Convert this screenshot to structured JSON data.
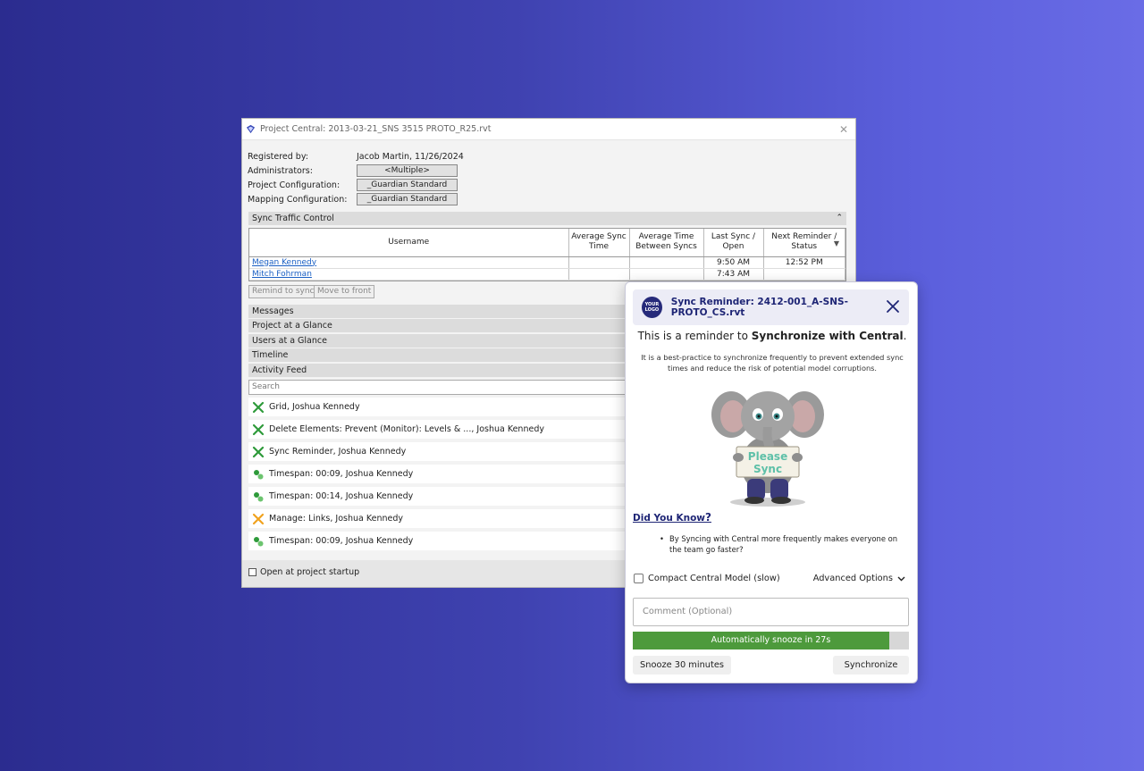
{
  "project_window": {
    "title": "Project Central: 2013-03-21_SNS 3515 PROTO_R25.rvt",
    "info": [
      {
        "label": "Registered by:",
        "value": "Jacob Martin, 11/26/2024"
      },
      {
        "label": "Administrators:",
        "value": "<Multiple>"
      },
      {
        "label": "Project Configuration:",
        "value": "_Guardian Standard"
      },
      {
        "label": "Mapping Configuration:",
        "value": "_Guardian Standard"
      }
    ],
    "sync_section": "Sync Traffic Control",
    "columns": [
      "Username",
      "Average Sync Time",
      "Average Time Between Syncs",
      "Last Sync / Open",
      "Next Reminder / Status"
    ],
    "rows": [
      {
        "user": "Megan Kennedy",
        "avg_sync": "",
        "avg_between": "",
        "last": "9:50 AM",
        "next": "12:52 PM"
      },
      {
        "user": "Mitch Fohrman",
        "avg_sync": "",
        "avg_between": "",
        "last": "7:43 AM",
        "next": ""
      }
    ],
    "buttons": {
      "remind": "Remind to sync",
      "move_front": "Move to front"
    },
    "sections": [
      "Messages",
      "Project at a Glance",
      "Users at a Glance",
      "Timeline",
      "Activity Feed"
    ],
    "search_placeholder": "Search",
    "feed": [
      {
        "text": "Grid, Joshua Kennedy",
        "icon": "tools-icon"
      },
      {
        "text": "Delete Elements: Prevent (Monitor): Levels & ..., Joshua Kennedy",
        "icon": "tools-icon"
      },
      {
        "text": "Sync Reminder, Joshua Kennedy",
        "icon": "tools-icon"
      },
      {
        "text": "Timespan: 00:09, Joshua Kennedy",
        "icon": "timespan-icon"
      },
      {
        "text": "Timespan: 00:14, Joshua Kennedy",
        "icon": "timespan-icon"
      },
      {
        "text": "Manage: Links, Joshua Kennedy",
        "icon": "tools-orange-icon"
      },
      {
        "text": "Timespan: 00:09, Joshua Kennedy",
        "icon": "timespan-icon"
      }
    ],
    "startup_label": "Open at project startup"
  },
  "reminder": {
    "logo_text": "YOUR LOGO",
    "title": "Sync Reminder: 2412-001_A-SNS-PROTO_CS.rvt",
    "heading_pre": "This is a reminder to ",
    "heading_bold": "Synchronize with Central",
    "heading_post": ".",
    "description": "It is a best-practice to synchronize frequently to prevent extended sync times and reduce the risk of potential model corruptions.",
    "sign_text_1": "Please",
    "sign_text_2": "Sync",
    "did_you_know": "Did You Know",
    "did_you_know_mark": "?",
    "tip": "By Syncing with Central more frequently makes everyone on the team go faster?",
    "compact_label": "Compact Central Model (slow)",
    "advanced_label": "Advanced Options",
    "comment_placeholder": "Comment (Optional)",
    "progress_label": "Automatically snooze in 27s",
    "progress_fraction": 0.93,
    "snooze_label": "Snooze 30 minutes",
    "sync_label": "Synchronize",
    "colors": {
      "accent": "#1e2575",
      "progress": "#4d9a3c"
    }
  }
}
